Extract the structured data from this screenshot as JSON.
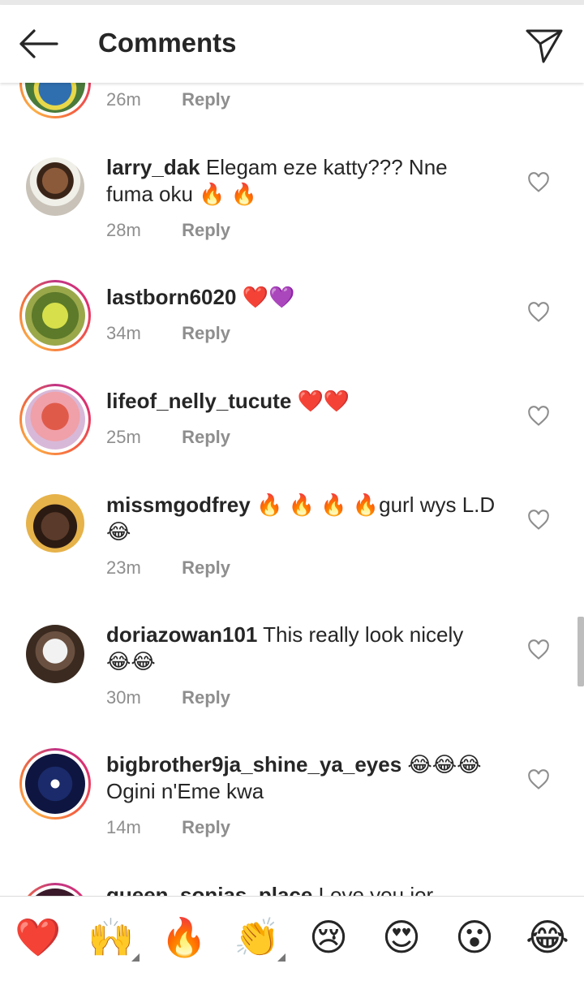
{
  "header": {
    "title": "Comments"
  },
  "comments": [
    {
      "time": "26m",
      "reply": "Reply"
    },
    {
      "user": "larry_dak",
      "text": "Elegam eze katty??? Nne",
      "text2": "fuma oku 🔥 🔥",
      "time": "28m",
      "reply": "Reply"
    },
    {
      "user": "lastborn6020",
      "text": "❤️💜",
      "time": "34m",
      "reply": "Reply"
    },
    {
      "user": "lifeof_nelly_tucute",
      "text": "❤️❤️",
      "time": "25m",
      "reply": "Reply"
    },
    {
      "user": "missmgodfrey",
      "text": "🔥 🔥 🔥 🔥gurl wys L.D",
      "text2": "😂",
      "time": "23m",
      "reply": "Reply"
    },
    {
      "user": "doriazowan101",
      "text": "This really look nicely",
      "text2": "😂😂",
      "time": "30m",
      "reply": "Reply"
    },
    {
      "user": "bigbrother9ja_shine_ya_eyes",
      "text": "😂😂😂",
      "text2": "Ogini n'Eme kwa",
      "time": "14m",
      "reply": "Reply"
    },
    {
      "user": "queen_sonias_place",
      "text": "Love you jor"
    }
  ],
  "emoji_bar": [
    "❤️",
    "🙌",
    "🔥",
    "👏",
    "😢",
    "😍",
    "😮",
    "😂"
  ],
  "colors": {
    "accent_ring_start": "#c13584",
    "accent_ring_end": "#fcaf45",
    "muted": "#8e8e8e",
    "text": "#262626"
  }
}
